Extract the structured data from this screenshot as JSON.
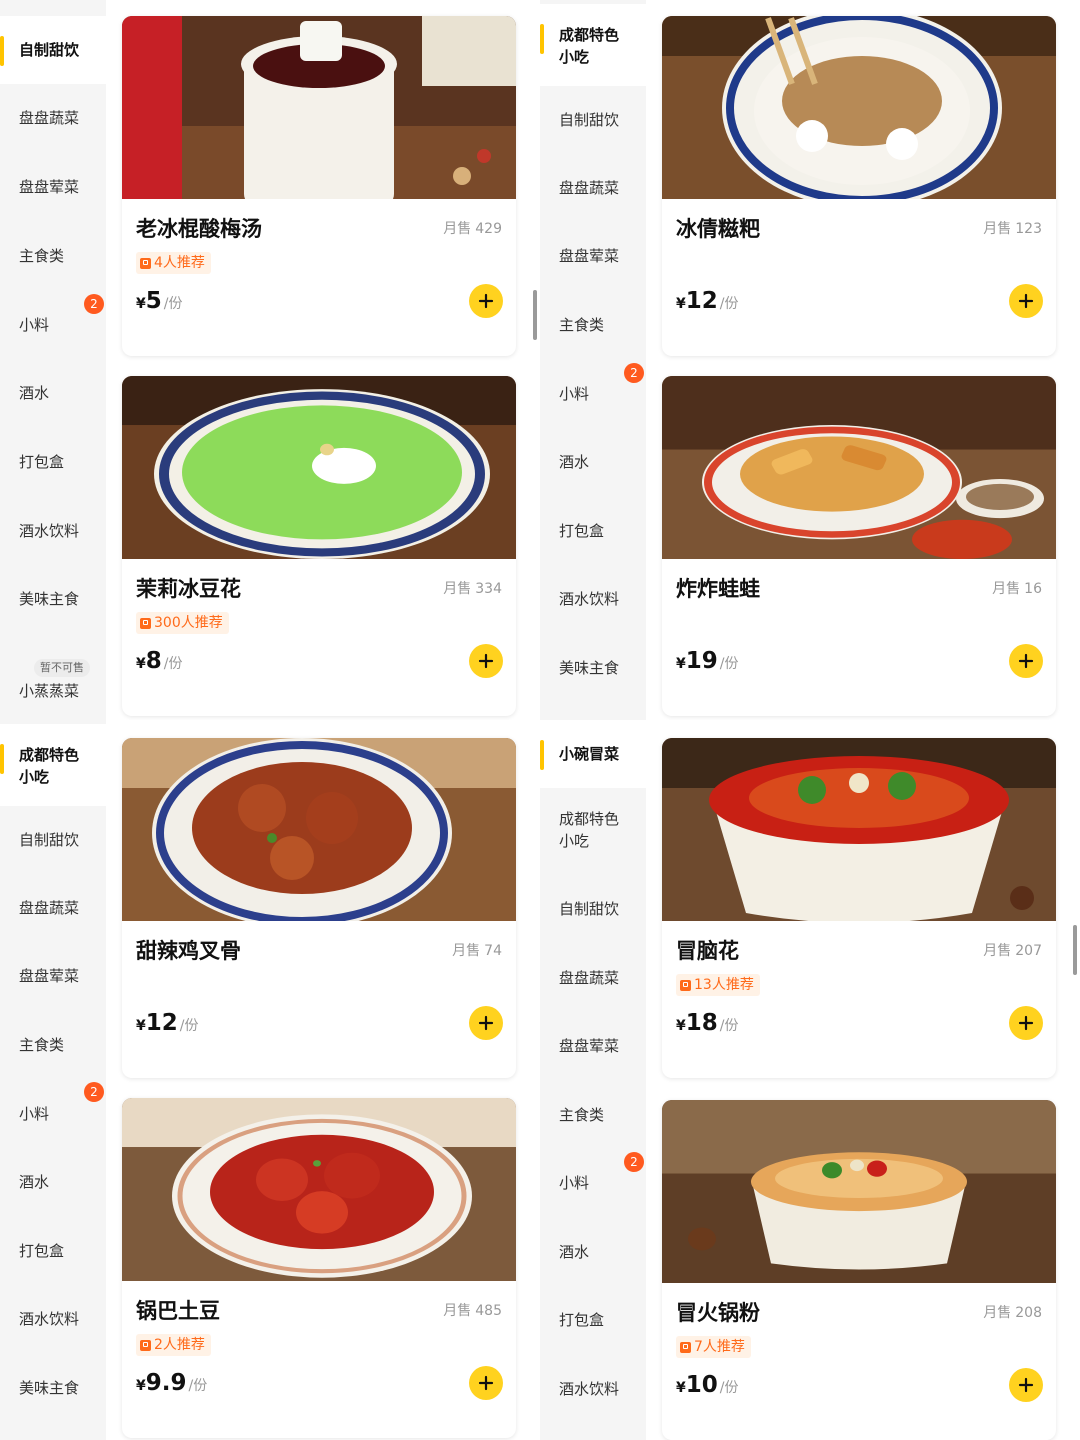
{
  "colors": {
    "accent": "#ffd21f",
    "badge": "#ff5a1f",
    "recommend": "#ff6a1a"
  },
  "panels": [
    {
      "categories": [
        {
          "label": "自制甜饮",
          "active": true
        },
        {
          "label": "盘盘蔬菜"
        },
        {
          "label": "盘盘荤菜"
        },
        {
          "label": "主食类"
        },
        {
          "label": "小料",
          "badge": "2"
        },
        {
          "label": "酒水"
        },
        {
          "label": "打包盒"
        },
        {
          "label": "酒水饮料"
        },
        {
          "label": "美味主食"
        },
        {
          "label": "小蒸蒸菜",
          "tag": "暂不可售"
        }
      ],
      "items": [
        {
          "name": "老冰棍酸梅汤",
          "sales_label": "月售",
          "sales": "429",
          "recommend": "4人推荐",
          "currency": "¥",
          "price": "5",
          "unit": "/份",
          "image_icon": "sour-plum-drink-photo"
        },
        {
          "name": "茉莉冰豆花",
          "sales_label": "月售",
          "sales": "334",
          "recommend": "300人推荐",
          "currency": "¥",
          "price": "8",
          "unit": "/份",
          "image_icon": "jasmine-tofu-pudding-photo"
        }
      ]
    },
    {
      "categories": [
        {
          "label": "成都特色",
          "label2": "小吃",
          "active": true
        },
        {
          "label": "自制甜饮"
        },
        {
          "label": "盘盘蔬菜"
        },
        {
          "label": "盘盘荤菜"
        },
        {
          "label": "主食类"
        },
        {
          "label": "小料",
          "badge": "2"
        },
        {
          "label": "酒水"
        },
        {
          "label": "打包盒"
        },
        {
          "label": "酒水饮料"
        },
        {
          "label": "美味主食"
        }
      ],
      "items": [
        {
          "name": "冰倩糍粑",
          "sales_label": "月售",
          "sales": "123",
          "currency": "¥",
          "price": "12",
          "unit": "/份",
          "image_icon": "rice-cake-photo"
        },
        {
          "name": "炸炸蛙蛙",
          "sales_label": "月售",
          "sales": "16",
          "currency": "¥",
          "price": "19",
          "unit": "/份",
          "image_icon": "fried-dough-photo"
        }
      ]
    },
    {
      "categories": [
        {
          "label": "成都特色",
          "label2": "小吃",
          "active": true
        },
        {
          "label": "自制甜饮"
        },
        {
          "label": "盘盘蔬菜"
        },
        {
          "label": "盘盘荤菜"
        },
        {
          "label": "主食类"
        },
        {
          "label": "小料",
          "badge": "2"
        },
        {
          "label": "酒水"
        },
        {
          "label": "打包盒"
        },
        {
          "label": "酒水饮料"
        },
        {
          "label": "美味主食"
        }
      ],
      "items": [
        {
          "name": "甜辣鸡叉骨",
          "sales_label": "月售",
          "sales": "74",
          "currency": "¥",
          "price": "12",
          "unit": "/份",
          "image_icon": "chicken-bones-photo"
        },
        {
          "name": "锅巴土豆",
          "sales_label": "月售",
          "sales": "485",
          "recommend": "2人推荐",
          "currency": "¥",
          "price": "9.9",
          "unit": "/份",
          "image_icon": "crispy-potato-photo"
        }
      ]
    },
    {
      "categories": [
        {
          "label": "小碗冒菜",
          "active": true
        },
        {
          "label": "成都特色",
          "label2": "小吃"
        },
        {
          "label": "自制甜饮"
        },
        {
          "label": "盘盘蔬菜"
        },
        {
          "label": "盘盘荤菜"
        },
        {
          "label": "主食类"
        },
        {
          "label": "小料",
          "badge": "2"
        },
        {
          "label": "酒水"
        },
        {
          "label": "打包盒"
        },
        {
          "label": "酒水饮料"
        }
      ],
      "items": [
        {
          "name": "冒脑花",
          "sales_label": "月售",
          "sales": "207",
          "recommend": "13人推荐",
          "currency": "¥",
          "price": "18",
          "unit": "/份",
          "image_icon": "spicy-brain-bowl-photo"
        },
        {
          "name": "冒火锅粉",
          "sales_label": "月售",
          "sales": "208",
          "recommend": "7人推荐",
          "currency": "¥",
          "price": "10",
          "unit": "/份",
          "image_icon": "hotpot-noodles-photo"
        }
      ]
    }
  ]
}
